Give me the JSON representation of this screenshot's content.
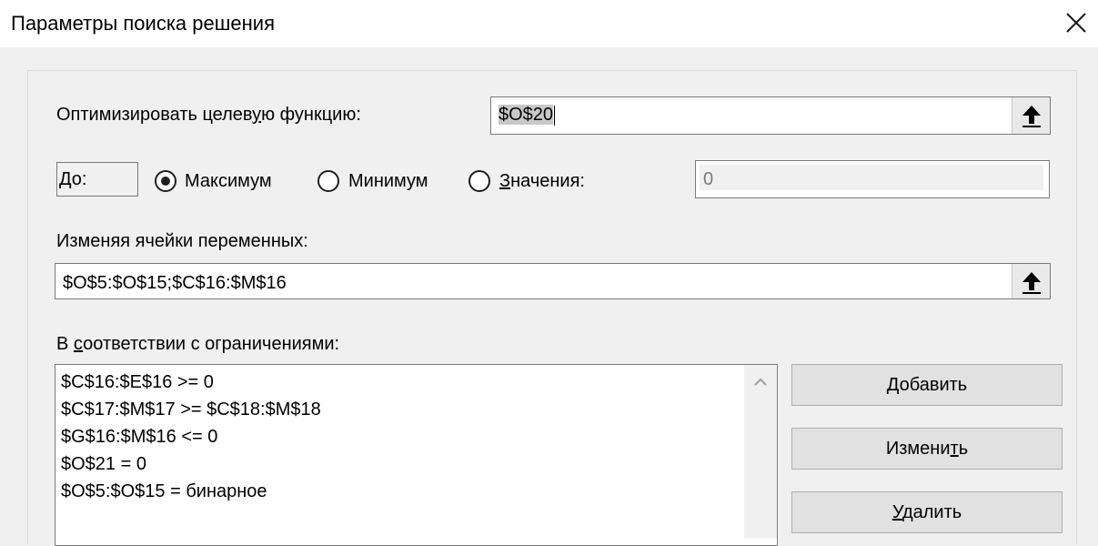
{
  "window": {
    "title": "Параметры поиска решения"
  },
  "objective": {
    "label_pre": "Оптимизировать целев",
    "label_u": "у",
    "label_post": "ю функцию:",
    "value": "$O$20"
  },
  "to": {
    "label": "До:",
    "options": {
      "max": "Максимум",
      "min": "Минимум",
      "value_u": "З",
      "value_rest": "начения:"
    },
    "selected": "max",
    "value_field": "0"
  },
  "variables": {
    "label": "Изменяя ячейки переменных:",
    "value": "$O$5:$O$15;$C$16:$M$16"
  },
  "constraints": {
    "label_pre": "В ",
    "label_u": "с",
    "label_post": "оответствии с ограничениями:",
    "items": [
      "$C$16:$E$16 >= 0",
      "$C$17:$M$17 >= $C$18:$M$18",
      "$G$16:$M$16 <= 0",
      "$O$21 = 0",
      "$O$5:$O$15 = бинарное"
    ]
  },
  "buttons": {
    "add_pre": "",
    "add_u": "Д",
    "add_post": "обавить",
    "change_pre": "Измени",
    "change_u": "т",
    "change_post": "ь",
    "delete_pre": "",
    "delete_u": "У",
    "delete_post": "далить"
  },
  "icons": {
    "close": "close-icon",
    "ref": "collapse-dialog-icon",
    "scroll_up": "chevron-up-icon"
  }
}
